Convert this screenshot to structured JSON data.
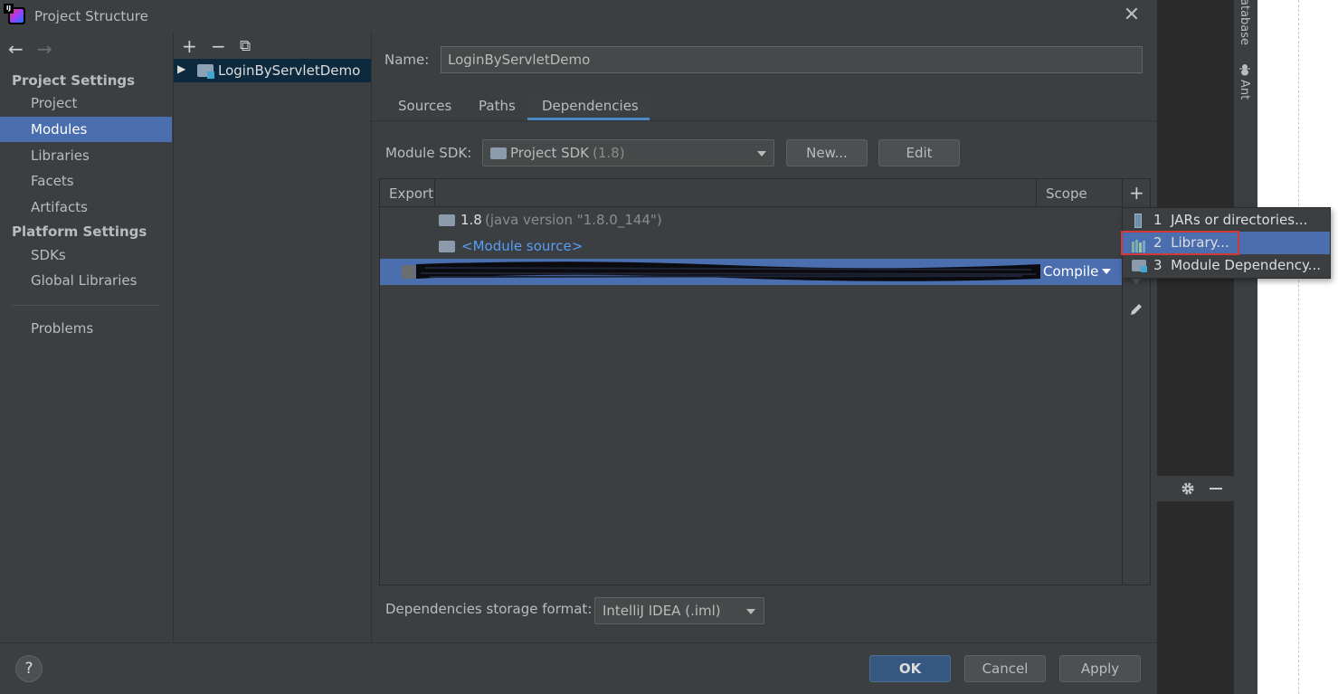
{
  "window": {
    "title": "Project Structure",
    "close_glyph": "✕",
    "app_icon_text": "IJ"
  },
  "ide_background": {
    "toolstrip_labels": [
      "atabase",
      "Ant"
    ]
  },
  "nav": {
    "back_glyph": "←",
    "forward_glyph": "→",
    "project_settings_header": "Project Settings",
    "project_items": [
      "Project",
      "Modules",
      "Libraries",
      "Facets",
      "Artifacts"
    ],
    "platform_settings_header": "Platform Settings",
    "platform_items": [
      "SDKs",
      "Global Libraries"
    ],
    "problems": "Problems",
    "selected": "Modules"
  },
  "tree": {
    "toolbar": {
      "add": "+",
      "remove": "−",
      "copy": "⧉"
    },
    "items": [
      {
        "label": "LoginByServletDemo",
        "expanded": false
      }
    ]
  },
  "module": {
    "name_label": "Name:",
    "name_value": "LoginByServletDemo",
    "tabs": [
      "Sources",
      "Paths",
      "Dependencies"
    ],
    "active_tab": "Dependencies",
    "sdk_label": "Module SDK:",
    "sdk_value": "Project SDK",
    "sdk_version": "(1.8)",
    "new_button": "New...",
    "edit_button": "Edit"
  },
  "dependencies": {
    "columns": {
      "export": "Export",
      "scope": "Scope"
    },
    "rows": [
      {
        "name": "1.8",
        "detail": "(java version \"1.8.0_144\")",
        "icon": "jdk-folder-icon"
      },
      {
        "name": "<Module source>",
        "icon": "module-source-folder-icon"
      },
      {
        "name": "",
        "scope": "Compile",
        "redacted": true,
        "selected": true
      }
    ],
    "toolbar": {
      "add": "+",
      "edit_icon": "pencil-icon"
    }
  },
  "add_popup": {
    "items": [
      {
        "number": "1",
        "label": "JARs or directories...",
        "icon": "jar-icon"
      },
      {
        "number": "2",
        "label": "Library...",
        "icon": "library-icon"
      },
      {
        "number": "3",
        "label": "Module Dependency...",
        "icon": "module-icon"
      }
    ],
    "selected_index": 1
  },
  "storage": {
    "label": "Dependencies storage format:",
    "value": "IntelliJ IDEA (.iml)"
  },
  "footer": {
    "help": "?",
    "ok": "OK",
    "cancel": "Cancel",
    "apply": "Apply"
  },
  "colors": {
    "selection": "#4b6eaf",
    "link": "#589df6",
    "highlight_border": "#d23838",
    "tab_underline": "#4a88c7"
  }
}
